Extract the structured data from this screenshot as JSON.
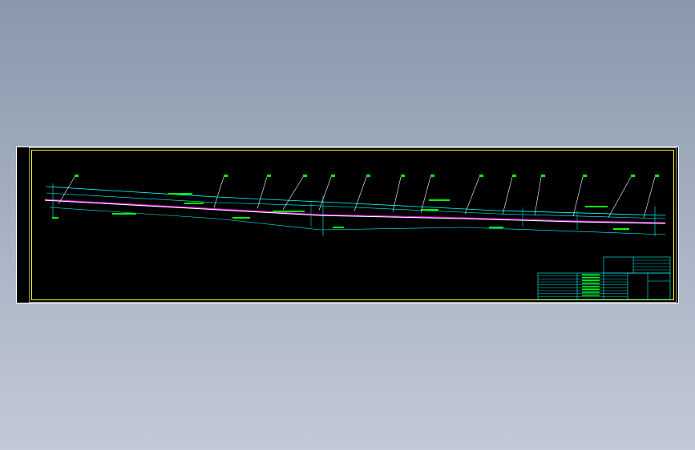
{
  "drawing": {
    "background": "#000000",
    "frame_color": "#ffffff",
    "border_color": "#ffff00",
    "line_color": "#00ffff",
    "text_color": "#00ff00",
    "centerline_color": "#ff00ff",
    "leader_color": "#ffffff",
    "callouts": [
      "",
      "",
      "",
      "",
      "",
      "",
      "",
      "",
      "",
      "",
      "",
      "",
      "",
      "",
      ""
    ],
    "title_block": {
      "small_table_rows": 9,
      "right_table_rows": 5
    }
  }
}
